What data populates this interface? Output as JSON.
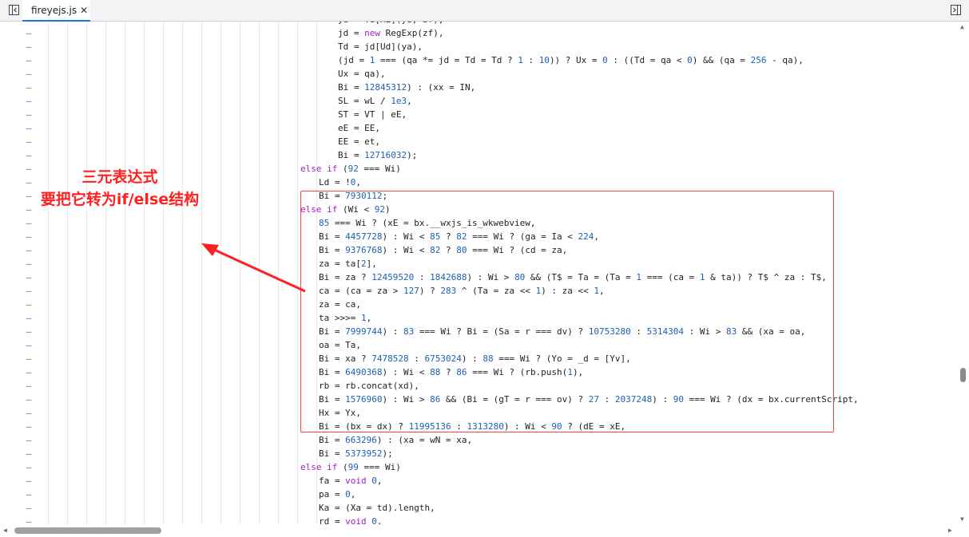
{
  "tab": {
    "filename": "fireyejs.js",
    "close": "✕"
  },
  "icons": {
    "left_panel": "panel-left-icon",
    "right_panel": "panel-right-icon",
    "close": "close-icon",
    "scroll_up": "chevron-up-icon",
    "scroll_down": "chevron-down-icon",
    "scroll_left": "chevron-left-icon",
    "scroll_right": "chevron-right-icon"
  },
  "gutter_marker": "–",
  "code_lines": [
    [
      [
        "t",
        "yd = Td[XE](yd, zf),"
      ]
    ],
    [
      [
        "t",
        "jd = "
      ],
      [
        "k",
        "new"
      ],
      [
        "t",
        " RegExp(zf),"
      ]
    ],
    [
      [
        "t",
        "Td = jd[Ud](ya),"
      ]
    ],
    [
      [
        "t",
        "(jd = "
      ],
      [
        "n",
        "1"
      ],
      [
        "t",
        " === (qa *= jd = Td = Td ? "
      ],
      [
        "n",
        "1"
      ],
      [
        "t",
        " : "
      ],
      [
        "n",
        "10"
      ],
      [
        "t",
        ")) ? Ux = "
      ],
      [
        "n",
        "0"
      ],
      [
        "t",
        " : ((Td = qa < "
      ],
      [
        "n",
        "0"
      ],
      [
        "t",
        ") && (qa = "
      ],
      [
        "n",
        "256"
      ],
      [
        "t",
        " - qa),"
      ]
    ],
    [
      [
        "t",
        "Ux = qa),"
      ]
    ],
    [
      [
        "t",
        "Bi = "
      ],
      [
        "n",
        "12845312"
      ],
      [
        "t",
        ") : (xx = IN,"
      ]
    ],
    [
      [
        "t",
        "SL = wL / "
      ],
      [
        "n",
        "1e3"
      ],
      [
        "t",
        ","
      ]
    ],
    [
      [
        "t",
        "ST = VT | eE,"
      ]
    ],
    [
      [
        "t",
        "eE = EE,"
      ]
    ],
    [
      [
        "t",
        "EE = et,"
      ]
    ],
    [
      [
        "t",
        "Bi = "
      ],
      [
        "n",
        "12716032"
      ],
      [
        "t",
        ");"
      ]
    ],
    [
      [
        "k",
        "else if"
      ],
      [
        "t",
        " ("
      ],
      [
        "n",
        "92"
      ],
      [
        "t",
        " === Wi)"
      ]
    ],
    [
      [
        "t",
        "Ld = !"
      ],
      [
        "n",
        "0"
      ],
      [
        "t",
        ","
      ]
    ],
    [
      [
        "t",
        "Bi = "
      ],
      [
        "n",
        "7930112"
      ],
      [
        "t",
        ";"
      ]
    ],
    [
      [
        "k",
        "else if"
      ],
      [
        "t",
        " (Wi < "
      ],
      [
        "n",
        "92"
      ],
      [
        "t",
        ")"
      ]
    ],
    [
      [
        "n",
        "85"
      ],
      [
        "t",
        " === Wi ? (xE = bx.__wxjs_is_wkwebview,"
      ]
    ],
    [
      [
        "t",
        "Bi = "
      ],
      [
        "n",
        "4457728"
      ],
      [
        "t",
        ") : Wi < "
      ],
      [
        "n",
        "85"
      ],
      [
        "t",
        " ? "
      ],
      [
        "n",
        "82"
      ],
      [
        "t",
        " === Wi ? (ga = Ia < "
      ],
      [
        "n",
        "224"
      ],
      [
        "t",
        ","
      ]
    ],
    [
      [
        "t",
        "Bi = "
      ],
      [
        "n",
        "9376768"
      ],
      [
        "t",
        ") : Wi < "
      ],
      [
        "n",
        "82"
      ],
      [
        "t",
        " ? "
      ],
      [
        "n",
        "80"
      ],
      [
        "t",
        " === Wi ? (cd = za,"
      ]
    ],
    [
      [
        "t",
        "za = ta["
      ],
      [
        "n",
        "2"
      ],
      [
        "t",
        "],"
      ]
    ],
    [
      [
        "t",
        "Bi = za ? "
      ],
      [
        "n",
        "12459520"
      ],
      [
        "t",
        " : "
      ],
      [
        "n",
        "1842688"
      ],
      [
        "t",
        ") : Wi > "
      ],
      [
        "n",
        "80"
      ],
      [
        "t",
        " && (T$ = Ta = (Ta = "
      ],
      [
        "n",
        "1"
      ],
      [
        "t",
        " === (ca = "
      ],
      [
        "n",
        "1"
      ],
      [
        "t",
        " & ta)) ? T$ ^ za : T$,"
      ]
    ],
    [
      [
        "t",
        "ca = (ca = za > "
      ],
      [
        "n",
        "127"
      ],
      [
        "t",
        ") ? "
      ],
      [
        "n",
        "283"
      ],
      [
        "t",
        " ^ (Ta = za << "
      ],
      [
        "n",
        "1"
      ],
      [
        "t",
        ") : za << "
      ],
      [
        "n",
        "1"
      ],
      [
        "t",
        ","
      ]
    ],
    [
      [
        "t",
        "za = ca,"
      ]
    ],
    [
      [
        "t",
        "ta >>>= "
      ],
      [
        "n",
        "1"
      ],
      [
        "t",
        ","
      ]
    ],
    [
      [
        "t",
        "Bi = "
      ],
      [
        "n",
        "7999744"
      ],
      [
        "t",
        ") : "
      ],
      [
        "n",
        "83"
      ],
      [
        "t",
        " === Wi ? Bi = (Sa = r === dv) ? "
      ],
      [
        "n",
        "10753280"
      ],
      [
        "t",
        " : "
      ],
      [
        "n",
        "5314304"
      ],
      [
        "t",
        " : Wi > "
      ],
      [
        "n",
        "83"
      ],
      [
        "t",
        " && (xa = oa,"
      ]
    ],
    [
      [
        "t",
        "oa = Ta,"
      ]
    ],
    [
      [
        "t",
        "Bi = xa ? "
      ],
      [
        "n",
        "7478528"
      ],
      [
        "t",
        " : "
      ],
      [
        "n",
        "6753024"
      ],
      [
        "t",
        ") : "
      ],
      [
        "n",
        "88"
      ],
      [
        "t",
        " === Wi ? (Yo = _d = [Yv],"
      ]
    ],
    [
      [
        "t",
        "Bi = "
      ],
      [
        "n",
        "6490368"
      ],
      [
        "t",
        ") : Wi < "
      ],
      [
        "n",
        "88"
      ],
      [
        "t",
        " ? "
      ],
      [
        "n",
        "86"
      ],
      [
        "t",
        " === Wi ? (rb.push("
      ],
      [
        "n",
        "1"
      ],
      [
        "t",
        "),"
      ]
    ],
    [
      [
        "t",
        "rb = rb.concat(xd),"
      ]
    ],
    [
      [
        "t",
        "Bi = "
      ],
      [
        "n",
        "1576960"
      ],
      [
        "t",
        ") : Wi > "
      ],
      [
        "n",
        "86"
      ],
      [
        "t",
        " && (Bi = (gT = r === ov) ? "
      ],
      [
        "n",
        "27"
      ],
      [
        "t",
        " : "
      ],
      [
        "n",
        "2037248"
      ],
      [
        "t",
        ") : "
      ],
      [
        "n",
        "90"
      ],
      [
        "t",
        " === Wi ? (dx = bx.currentScript,"
      ]
    ],
    [
      [
        "t",
        "Hx = Yx,"
      ]
    ],
    [
      [
        "t",
        "Bi = (bx = dx) ? "
      ],
      [
        "n",
        "11995136"
      ],
      [
        "t",
        " : "
      ],
      [
        "n",
        "1313280"
      ],
      [
        "t",
        ") : Wi < "
      ],
      [
        "n",
        "90"
      ],
      [
        "t",
        " ? (dE = xE,"
      ]
    ],
    [
      [
        "t",
        "Bi = "
      ],
      [
        "n",
        "663296"
      ],
      [
        "t",
        ") : (xa = wN = xa,"
      ]
    ],
    [
      [
        "t",
        "Bi = "
      ],
      [
        "n",
        "5373952"
      ],
      [
        "t",
        ");"
      ]
    ],
    [
      [
        "k",
        "else if"
      ],
      [
        "t",
        " ("
      ],
      [
        "n",
        "99"
      ],
      [
        "t",
        " === Wi)"
      ]
    ],
    [
      [
        "t",
        "fa = "
      ],
      [
        "k",
        "void"
      ],
      [
        "t",
        " "
      ],
      [
        "n",
        "0"
      ],
      [
        "t",
        ","
      ]
    ],
    [
      [
        "t",
        "pa = "
      ],
      [
        "n",
        "0"
      ],
      [
        "t",
        ","
      ]
    ],
    [
      [
        "t",
        "Ka = (Xa = td).length,"
      ]
    ],
    [
      [
        "t",
        "rd = "
      ],
      [
        "k",
        "void"
      ],
      [
        "t",
        " "
      ],
      [
        "n",
        "0"
      ],
      [
        "t",
        ","
      ]
    ]
  ],
  "annotation": {
    "line1": "三元表达式",
    "line2": "要把它转为if/else结构"
  },
  "colors": {
    "keyword": "#a21ecc",
    "number": "#1c5fb5",
    "annotation_red": "#ff2020",
    "active_tab_underline": "#1a73e8"
  },
  "vertical_scroll_fraction": 0.66,
  "horizontal_scroll_fraction": 0.0
}
